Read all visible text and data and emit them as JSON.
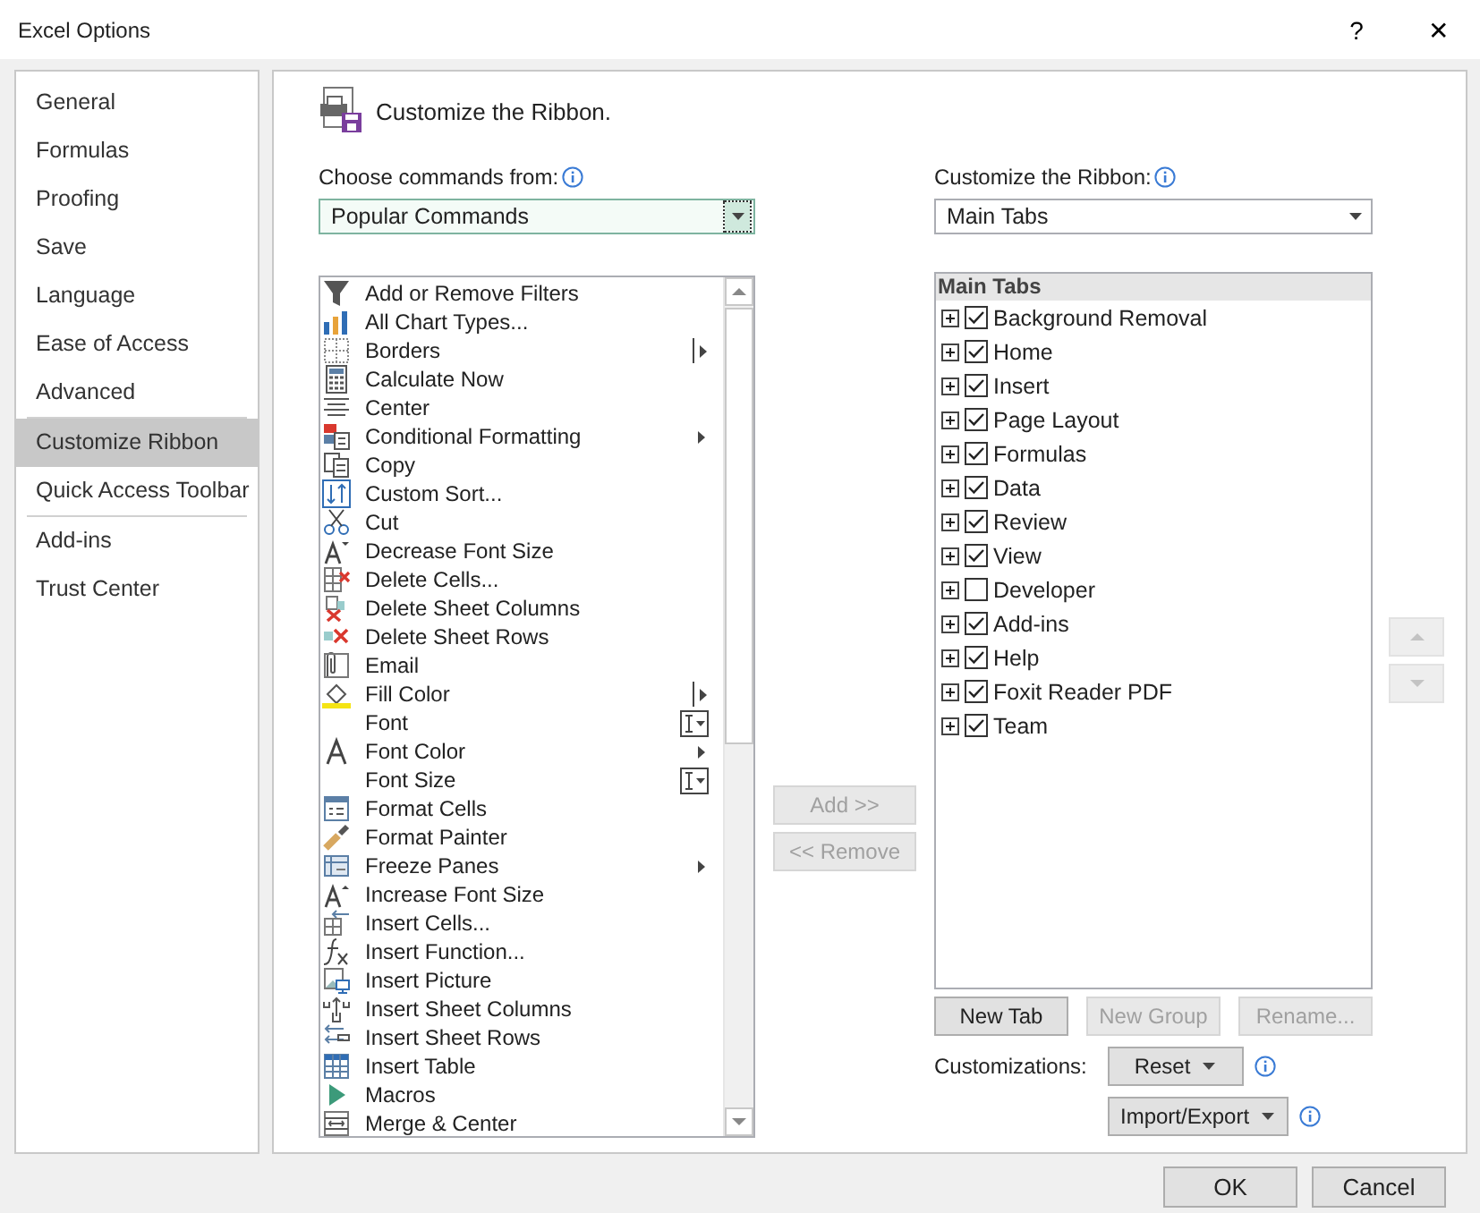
{
  "window": {
    "title": "Excel Options",
    "help": "?",
    "close": "✕"
  },
  "sidebar": {
    "items": [
      {
        "label": "General",
        "selected": false,
        "divider_after": false
      },
      {
        "label": "Formulas",
        "selected": false,
        "divider_after": false
      },
      {
        "label": "Proofing",
        "selected": false,
        "divider_after": false
      },
      {
        "label": "Save",
        "selected": false,
        "divider_after": false
      },
      {
        "label": "Language",
        "selected": false,
        "divider_after": false
      },
      {
        "label": "Ease of Access",
        "selected": false,
        "divider_after": false
      },
      {
        "label": "Advanced",
        "selected": false,
        "divider_after": true
      },
      {
        "label": "Customize Ribbon",
        "selected": true,
        "divider_after": false
      },
      {
        "label": "Quick Access Toolbar",
        "selected": false,
        "divider_after": true
      },
      {
        "label": "Add-ins",
        "selected": false,
        "divider_after": false
      },
      {
        "label": "Trust Center",
        "selected": false,
        "divider_after": false
      }
    ]
  },
  "heading": "Customize the Ribbon.",
  "commands_from": {
    "label": "Choose commands from:",
    "value": "Popular Commands"
  },
  "commands": [
    {
      "label": "Add or Remove Filters",
      "kind": "plain"
    },
    {
      "label": "All Chart Types...",
      "kind": "plain"
    },
    {
      "label": "Borders",
      "kind": "split"
    },
    {
      "label": "Calculate Now",
      "kind": "plain"
    },
    {
      "label": "Center",
      "kind": "plain"
    },
    {
      "label": "Conditional Formatting",
      "kind": "submenu"
    },
    {
      "label": "Copy",
      "kind": "plain"
    },
    {
      "label": "Custom Sort...",
      "kind": "plain"
    },
    {
      "label": "Cut",
      "kind": "plain"
    },
    {
      "label": "Decrease Font Size",
      "kind": "plain"
    },
    {
      "label": "Delete Cells...",
      "kind": "plain"
    },
    {
      "label": "Delete Sheet Columns",
      "kind": "plain"
    },
    {
      "label": "Delete Sheet Rows",
      "kind": "plain"
    },
    {
      "label": "Email",
      "kind": "plain"
    },
    {
      "label": "Fill Color",
      "kind": "split"
    },
    {
      "label": "Font",
      "kind": "combo"
    },
    {
      "label": "Font Color",
      "kind": "submenu"
    },
    {
      "label": "Font Size",
      "kind": "combo"
    },
    {
      "label": "Format Cells",
      "kind": "plain"
    },
    {
      "label": "Format Painter",
      "kind": "plain"
    },
    {
      "label": "Freeze Panes",
      "kind": "submenu"
    },
    {
      "label": "Increase Font Size",
      "kind": "plain"
    },
    {
      "label": "Insert Cells...",
      "kind": "plain"
    },
    {
      "label": "Insert Function...",
      "kind": "plain"
    },
    {
      "label": "Insert Picture",
      "kind": "plain"
    },
    {
      "label": "Insert Sheet Columns",
      "kind": "plain"
    },
    {
      "label": "Insert Sheet Rows",
      "kind": "plain"
    },
    {
      "label": "Insert Table",
      "kind": "plain"
    },
    {
      "label": "Macros",
      "kind": "plain"
    },
    {
      "label": "Merge & Center",
      "kind": "plain"
    }
  ],
  "add_button": {
    "label": "Add >>",
    "disabled": true
  },
  "remove_button": {
    "label": "<< Remove",
    "disabled": true
  },
  "ribbon": {
    "label": "Customize the Ribbon:",
    "value": "Main Tabs"
  },
  "tree": {
    "header": "Main Tabs",
    "items": [
      {
        "label": "Background Removal",
        "checked": true
      },
      {
        "label": "Home",
        "checked": true
      },
      {
        "label": "Insert",
        "checked": true
      },
      {
        "label": "Page Layout",
        "checked": true
      },
      {
        "label": "Formulas",
        "checked": true
      },
      {
        "label": "Data",
        "checked": true
      },
      {
        "label": "Review",
        "checked": true
      },
      {
        "label": "View",
        "checked": true
      },
      {
        "label": "Developer",
        "checked": false
      },
      {
        "label": "Add-ins",
        "checked": true
      },
      {
        "label": "Help",
        "checked": true
      },
      {
        "label": "Foxit Reader PDF",
        "checked": true
      },
      {
        "label": "Team",
        "checked": true
      }
    ]
  },
  "move_buttons": [
    {
      "kind": "up",
      "disabled": true
    },
    {
      "kind": "down",
      "disabled": true
    }
  ],
  "tree_buttons": [
    {
      "label": "New Tab",
      "disabled": false
    },
    {
      "label": "New Group",
      "disabled": true
    },
    {
      "label": "Rename...",
      "disabled": true
    }
  ],
  "customizations": {
    "label": "Customizations:",
    "reset": "Reset",
    "import_export": "Import/Export"
  },
  "footer": [
    {
      "label": "OK"
    },
    {
      "label": "Cancel"
    }
  ]
}
